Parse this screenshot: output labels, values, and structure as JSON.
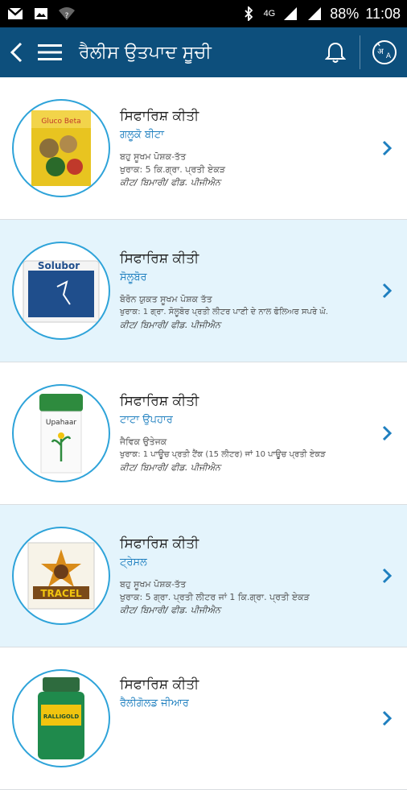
{
  "status_bar": {
    "network": "4G",
    "battery": "88%",
    "time": "11:08"
  },
  "app_bar": {
    "title": "ਰੈਲੀਸ ਉਤਪਾਦ ਸੂਚੀ"
  },
  "products": [
    {
      "recommended": "ਸਿਫਾਰਿਸ਼ ਕੀਤੀ",
      "name": "ਗਲੂਕੋ ਬੀਟਾ",
      "type": "ਬਹੁ ਸੂਖਮ ਪੋਸ਼ਕ-ਤੱਤ",
      "dosage": "ਖੁਰਾਕ: 5 ਕਿ.ਗ੍ਰਾ. ਪ੍ਰਤੀ ਏਕੜ",
      "meta": "ਕੀਟ/ ਬਿਮਾਰੀ/ ਫੀਡ. ਪੀਜੀਐਨ",
      "thumb_label": "Gluco Beta"
    },
    {
      "recommended": "ਸਿਫਾਰਿਸ਼ ਕੀਤੀ",
      "name": "ਸੋਲੂਬੋਰ",
      "type": "ਬੋਰੋਨ ਯੁਕਤ ਸੂਖਮ ਪੋਸ਼ਕ ਤੱਤ",
      "dosage": "ਖੁਰਾਕ: 1 ਗ੍ਰਾ. ਸੋਲੂਬੋਰ ਪ੍ਰਤੀ ਲੀਟਰ ਪਾਣੀ ਦੇ ਨਾਲ ਫੋਲਿਅਰ ਸਪਰੇ ਘੋ.",
      "meta": "ਕੀਟ/ ਬਿਮਾਰੀ/ ਫੀਡ. ਪੀਜੀਐਨ",
      "thumb_label": "Solubor"
    },
    {
      "recommended": "ਸਿਫਾਰਿਸ਼ ਕੀਤੀ",
      "name": "ਟਾਟਾ ਉਪਹਾਰ",
      "type": "ਜੈਵਿਕ ਉਤੇਜਕ",
      "dosage": "ਖੁਰਾਕ: 1 ਪਾਊਚ ਪ੍ਰਤੀ ਟੈਂਕ (15 ਲੀਟਰ) ਜਾਂ 10 ਪਾਊਚ ਪ੍ਰਤੀ ਏਕੜ",
      "meta": "ਕੀਟ/ ਬਿਮਾਰੀ/ ਫੀਡ. ਪੀਜੀਐਨ",
      "thumb_label": "Upahaar"
    },
    {
      "recommended": "ਸਿਫਾਰਿਸ਼ ਕੀਤੀ",
      "name": "ਟ੍ਰੇਸਲ",
      "type": "ਬਹੁ ਸੂਖਮ ਪੋਸ਼ਕ-ਤੱਤ",
      "dosage": "ਖੁਰਾਕ: 5 ਗ੍ਰਾ. ਪ੍ਰਤੀ ਲੀਟਰ ਜਾਂ 1 ਕਿ.ਗ੍ਰਾ. ਪ੍ਰਤੀ ਏਕੜ",
      "meta": "ਕੀਟ/ ਬਿਮਾਰੀ/ ਫੀਡ. ਪੀਜੀਐਨ",
      "thumb_label": "TRACEL"
    },
    {
      "recommended": "ਸਿਫਾਰਿਸ਼ ਕੀਤੀ",
      "name": "ਰੈਲੀਗੋਲਡ ਜੀਆਰ",
      "type": "",
      "dosage": "",
      "meta": "",
      "thumb_label": "RALLIGOLD"
    }
  ],
  "colors": {
    "app_bar": "#0d4f7c",
    "accent": "#2ea3d9",
    "alt_row": "#e4f4fc"
  }
}
